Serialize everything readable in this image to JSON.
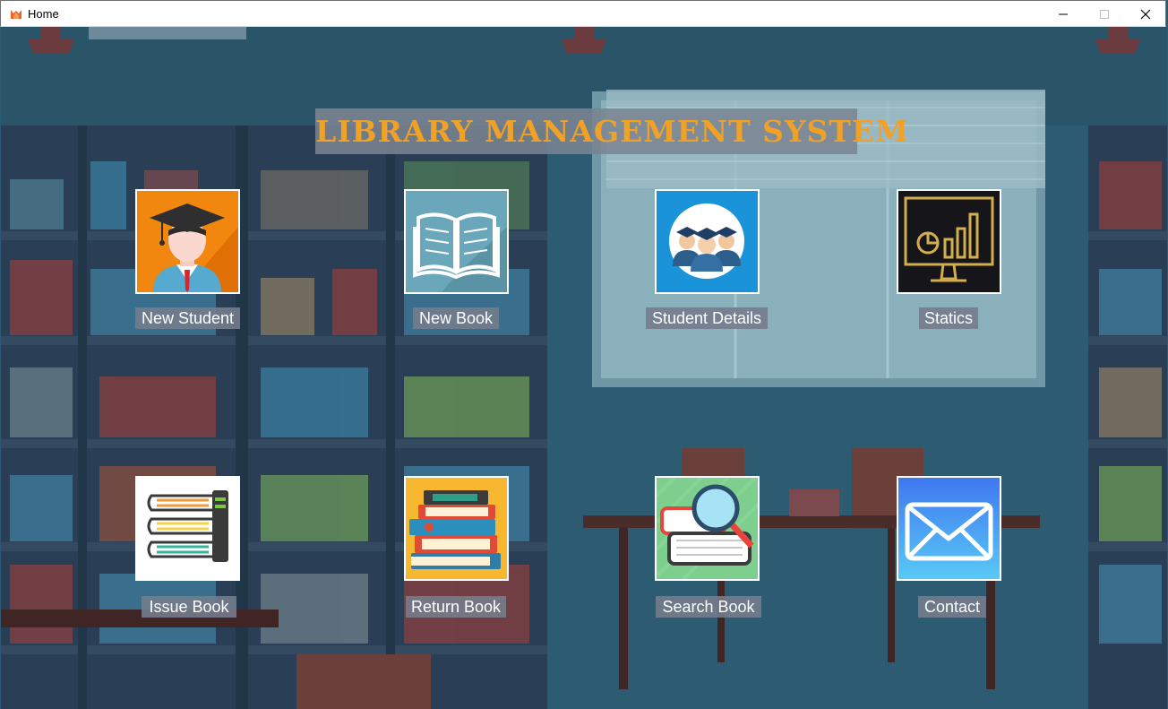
{
  "window": {
    "title": "Home",
    "buttons": [
      "minimize-button",
      "maximize-button",
      "close-button"
    ]
  },
  "app_title": "LIBRARY MANAGEMENT SYSTEM",
  "colors": {
    "title_text": "#f0a126",
    "label_bg": "#747c8c",
    "wall": "#2c5a72"
  },
  "tiles": [
    {
      "label": "New Student",
      "icon": "graduate-student-icon"
    },
    {
      "label": "New Book",
      "icon": "open-book-icon"
    },
    {
      "label": "Student Details",
      "icon": "students-group-icon"
    },
    {
      "label": "Statics",
      "icon": "statistics-monitor-icon"
    },
    {
      "label": "Issue Book",
      "icon": "book-stack-issue-icon"
    },
    {
      "label": "Return Book",
      "icon": "book-pile-icon"
    },
    {
      "label": "Search Book",
      "icon": "magnifier-book-icon"
    },
    {
      "label": "Contact",
      "icon": "envelope-icon"
    }
  ]
}
